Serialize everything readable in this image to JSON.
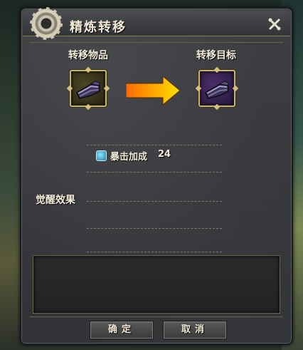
{
  "window": {
    "title": "精炼转移",
    "icon": "gear-icon",
    "close_icon": "tools-close-icon"
  },
  "transfer": {
    "source_label": "转移物品",
    "target_label": "转移目标",
    "source_item_icon": "gauntlet-icon",
    "target_item_icon": "gauntlet-icon",
    "arrow_icon": "arrow-right-icon"
  },
  "stats": {
    "name": "暴击加成",
    "value": "24",
    "icon": "gem-icon"
  },
  "awaken": {
    "label": "觉醒效果"
  },
  "buttons": {
    "confirm": "确定",
    "cancel": "取消"
  },
  "colors": {
    "arrow_start": "#ff6a00",
    "arrow_end": "#ffe000",
    "frame_gold": "#c9b26a"
  }
}
